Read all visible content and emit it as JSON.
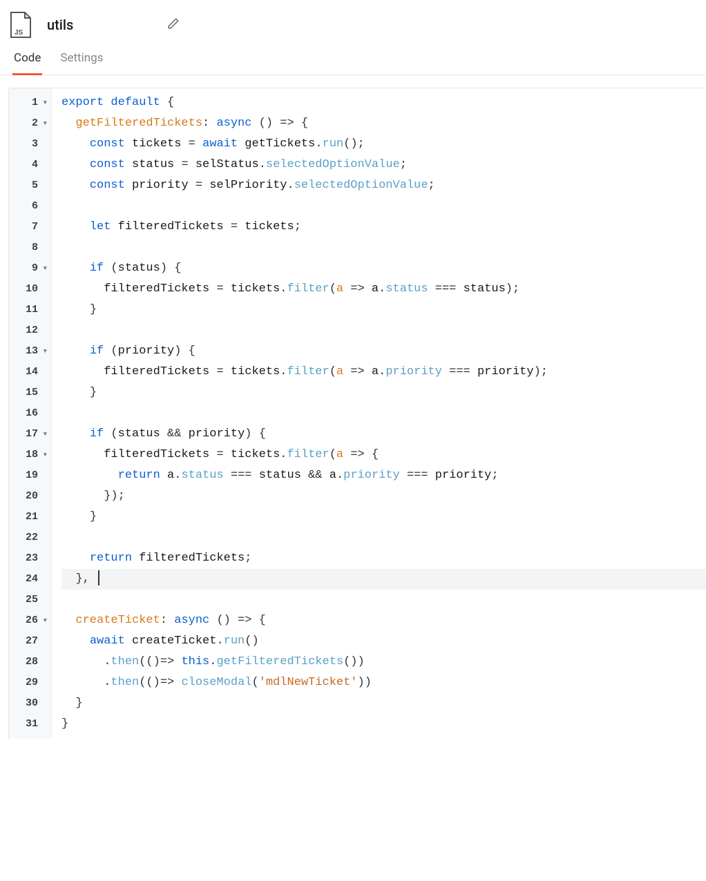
{
  "header": {
    "file_type": "JS",
    "title": "utils"
  },
  "tabs": [
    {
      "label": "Code",
      "active": true
    },
    {
      "label": "Settings",
      "active": false
    }
  ],
  "editor": {
    "highlighted_line": 24,
    "lines": [
      {
        "n": 1,
        "fold": true,
        "tokens": [
          [
            "kw",
            "export"
          ],
          [
            "sp",
            " "
          ],
          [
            "kw",
            "default"
          ],
          [
            "sp",
            " "
          ],
          [
            "op",
            "{"
          ]
        ]
      },
      {
        "n": 2,
        "fold": true,
        "tokens": [
          [
            "sp",
            "  "
          ],
          [
            "def",
            "getFilteredTickets"
          ],
          [
            "op",
            ":"
          ],
          [
            "sp",
            " "
          ],
          [
            "kw",
            "async"
          ],
          [
            "sp",
            " "
          ],
          [
            "op",
            "()"
          ],
          [
            "sp",
            " "
          ],
          [
            "op",
            "=>"
          ],
          [
            "sp",
            " "
          ],
          [
            "op",
            "{"
          ]
        ]
      },
      {
        "n": 3,
        "fold": false,
        "tokens": [
          [
            "sp",
            "    "
          ],
          [
            "kw",
            "const"
          ],
          [
            "sp",
            " "
          ],
          [
            "txt",
            "tickets"
          ],
          [
            "sp",
            " "
          ],
          [
            "op",
            "="
          ],
          [
            "sp",
            " "
          ],
          [
            "kw",
            "await"
          ],
          [
            "sp",
            " "
          ],
          [
            "txt",
            "getTickets"
          ],
          [
            "op",
            "."
          ],
          [
            "fn",
            "run"
          ],
          [
            "op",
            "();"
          ]
        ]
      },
      {
        "n": 4,
        "fold": false,
        "tokens": [
          [
            "sp",
            "    "
          ],
          [
            "kw",
            "const"
          ],
          [
            "sp",
            " "
          ],
          [
            "txt",
            "status"
          ],
          [
            "sp",
            " "
          ],
          [
            "op",
            "="
          ],
          [
            "sp",
            " "
          ],
          [
            "txt",
            "selStatus"
          ],
          [
            "op",
            "."
          ],
          [
            "prop",
            "selectedOptionValue"
          ],
          [
            "op",
            ";"
          ]
        ]
      },
      {
        "n": 5,
        "fold": false,
        "tokens": [
          [
            "sp",
            "    "
          ],
          [
            "kw",
            "const"
          ],
          [
            "sp",
            " "
          ],
          [
            "txt",
            "priority"
          ],
          [
            "sp",
            " "
          ],
          [
            "op",
            "="
          ],
          [
            "sp",
            " "
          ],
          [
            "txt",
            "selPriority"
          ],
          [
            "op",
            "."
          ],
          [
            "prop",
            "selectedOptionValue"
          ],
          [
            "op",
            ";"
          ]
        ]
      },
      {
        "n": 6,
        "fold": false,
        "tokens": []
      },
      {
        "n": 7,
        "fold": false,
        "tokens": [
          [
            "sp",
            "    "
          ],
          [
            "kw",
            "let"
          ],
          [
            "sp",
            " "
          ],
          [
            "txt",
            "filteredTickets"
          ],
          [
            "sp",
            " "
          ],
          [
            "op",
            "="
          ],
          [
            "sp",
            " "
          ],
          [
            "txt",
            "tickets"
          ],
          [
            "op",
            ";"
          ]
        ]
      },
      {
        "n": 8,
        "fold": false,
        "tokens": []
      },
      {
        "n": 9,
        "fold": true,
        "tokens": [
          [
            "sp",
            "    "
          ],
          [
            "kw",
            "if"
          ],
          [
            "sp",
            " "
          ],
          [
            "op",
            "("
          ],
          [
            "txt",
            "status"
          ],
          [
            "op",
            ")"
          ],
          [
            "sp",
            " "
          ],
          [
            "op",
            "{"
          ]
        ]
      },
      {
        "n": 10,
        "fold": false,
        "tokens": [
          [
            "sp",
            "      "
          ],
          [
            "txt",
            "filteredTickets"
          ],
          [
            "sp",
            " "
          ],
          [
            "op",
            "="
          ],
          [
            "sp",
            " "
          ],
          [
            "txt",
            "tickets"
          ],
          [
            "op",
            "."
          ],
          [
            "fn",
            "filter"
          ],
          [
            "op",
            "("
          ],
          [
            "param",
            "a"
          ],
          [
            "sp",
            " "
          ],
          [
            "op",
            "=>"
          ],
          [
            "sp",
            " "
          ],
          [
            "txt",
            "a"
          ],
          [
            "op",
            "."
          ],
          [
            "prop",
            "status"
          ],
          [
            "sp",
            " "
          ],
          [
            "op",
            "==="
          ],
          [
            "sp",
            " "
          ],
          [
            "txt",
            "status"
          ],
          [
            "op",
            ");"
          ]
        ]
      },
      {
        "n": 11,
        "fold": false,
        "tokens": [
          [
            "sp",
            "    "
          ],
          [
            "op",
            "}"
          ]
        ]
      },
      {
        "n": 12,
        "fold": false,
        "tokens": []
      },
      {
        "n": 13,
        "fold": true,
        "tokens": [
          [
            "sp",
            "    "
          ],
          [
            "kw",
            "if"
          ],
          [
            "sp",
            " "
          ],
          [
            "op",
            "("
          ],
          [
            "txt",
            "priority"
          ],
          [
            "op",
            ")"
          ],
          [
            "sp",
            " "
          ],
          [
            "op",
            "{"
          ]
        ]
      },
      {
        "n": 14,
        "fold": false,
        "tokens": [
          [
            "sp",
            "      "
          ],
          [
            "txt",
            "filteredTickets"
          ],
          [
            "sp",
            " "
          ],
          [
            "op",
            "="
          ],
          [
            "sp",
            " "
          ],
          [
            "txt",
            "tickets"
          ],
          [
            "op",
            "."
          ],
          [
            "fn",
            "filter"
          ],
          [
            "op",
            "("
          ],
          [
            "param",
            "a"
          ],
          [
            "sp",
            " "
          ],
          [
            "op",
            "=>"
          ],
          [
            "sp",
            " "
          ],
          [
            "txt",
            "a"
          ],
          [
            "op",
            "."
          ],
          [
            "prop",
            "priority"
          ],
          [
            "sp",
            " "
          ],
          [
            "op",
            "==="
          ],
          [
            "sp",
            " "
          ],
          [
            "txt",
            "priority"
          ],
          [
            "op",
            ");"
          ]
        ]
      },
      {
        "n": 15,
        "fold": false,
        "tokens": [
          [
            "sp",
            "    "
          ],
          [
            "op",
            "}"
          ]
        ]
      },
      {
        "n": 16,
        "fold": false,
        "tokens": []
      },
      {
        "n": 17,
        "fold": true,
        "tokens": [
          [
            "sp",
            "    "
          ],
          [
            "kw",
            "if"
          ],
          [
            "sp",
            " "
          ],
          [
            "op",
            "("
          ],
          [
            "txt",
            "status"
          ],
          [
            "sp",
            " "
          ],
          [
            "op",
            "&&"
          ],
          [
            "sp",
            " "
          ],
          [
            "txt",
            "priority"
          ],
          [
            "op",
            ")"
          ],
          [
            "sp",
            " "
          ],
          [
            "op",
            "{"
          ]
        ]
      },
      {
        "n": 18,
        "fold": true,
        "tokens": [
          [
            "sp",
            "      "
          ],
          [
            "txt",
            "filteredTickets"
          ],
          [
            "sp",
            " "
          ],
          [
            "op",
            "="
          ],
          [
            "sp",
            " "
          ],
          [
            "txt",
            "tickets"
          ],
          [
            "op",
            "."
          ],
          [
            "fn",
            "filter"
          ],
          [
            "op",
            "("
          ],
          [
            "param",
            "a"
          ],
          [
            "sp",
            " "
          ],
          [
            "op",
            "=>"
          ],
          [
            "sp",
            " "
          ],
          [
            "op",
            "{"
          ]
        ]
      },
      {
        "n": 19,
        "fold": false,
        "tokens": [
          [
            "sp",
            "        "
          ],
          [
            "kw",
            "return"
          ],
          [
            "sp",
            " "
          ],
          [
            "txt",
            "a"
          ],
          [
            "op",
            "."
          ],
          [
            "prop",
            "status"
          ],
          [
            "sp",
            " "
          ],
          [
            "op",
            "==="
          ],
          [
            "sp",
            " "
          ],
          [
            "txt",
            "status"
          ],
          [
            "sp",
            " "
          ],
          [
            "op",
            "&&"
          ],
          [
            "sp",
            " "
          ],
          [
            "txt",
            "a"
          ],
          [
            "op",
            "."
          ],
          [
            "prop",
            "priority"
          ],
          [
            "sp",
            " "
          ],
          [
            "op",
            "==="
          ],
          [
            "sp",
            " "
          ],
          [
            "txt",
            "priority"
          ],
          [
            "op",
            ";"
          ]
        ]
      },
      {
        "n": 20,
        "fold": false,
        "tokens": [
          [
            "sp",
            "      "
          ],
          [
            "op",
            "});"
          ]
        ]
      },
      {
        "n": 21,
        "fold": false,
        "tokens": [
          [
            "sp",
            "    "
          ],
          [
            "op",
            "}"
          ]
        ]
      },
      {
        "n": 22,
        "fold": false,
        "tokens": []
      },
      {
        "n": 23,
        "fold": false,
        "tokens": [
          [
            "sp",
            "    "
          ],
          [
            "kw",
            "return"
          ],
          [
            "sp",
            " "
          ],
          [
            "txt",
            "filteredTickets"
          ],
          [
            "op",
            ";"
          ]
        ]
      },
      {
        "n": 24,
        "fold": false,
        "tokens": [
          [
            "sp",
            "  "
          ],
          [
            "op",
            "},"
          ],
          [
            "sp",
            " "
          ],
          [
            "cursor",
            ""
          ]
        ]
      },
      {
        "n": 25,
        "fold": false,
        "tokens": []
      },
      {
        "n": 26,
        "fold": true,
        "tokens": [
          [
            "sp",
            "  "
          ],
          [
            "def",
            "createTicket"
          ],
          [
            "op",
            ":"
          ],
          [
            "sp",
            " "
          ],
          [
            "kw",
            "async"
          ],
          [
            "sp",
            " "
          ],
          [
            "op",
            "()"
          ],
          [
            "sp",
            " "
          ],
          [
            "op",
            "=>"
          ],
          [
            "sp",
            " "
          ],
          [
            "op",
            "{"
          ]
        ]
      },
      {
        "n": 27,
        "fold": false,
        "tokens": [
          [
            "sp",
            "    "
          ],
          [
            "kw",
            "await"
          ],
          [
            "sp",
            " "
          ],
          [
            "txt",
            "createTicket"
          ],
          [
            "op",
            "."
          ],
          [
            "fn",
            "run"
          ],
          [
            "op",
            "()"
          ]
        ]
      },
      {
        "n": 28,
        "fold": false,
        "tokens": [
          [
            "sp",
            "      "
          ],
          [
            "op",
            "."
          ],
          [
            "fn",
            "then"
          ],
          [
            "op",
            "(()"
          ],
          [
            "op",
            "=>"
          ],
          [
            "sp",
            " "
          ],
          [
            "this",
            "this"
          ],
          [
            "op",
            "."
          ],
          [
            "fn",
            "getFilteredTickets"
          ],
          [
            "op",
            "())"
          ]
        ]
      },
      {
        "n": 29,
        "fold": false,
        "tokens": [
          [
            "sp",
            "      "
          ],
          [
            "op",
            "."
          ],
          [
            "fn",
            "then"
          ],
          [
            "op",
            "(()"
          ],
          [
            "op",
            "=>"
          ],
          [
            "sp",
            " "
          ],
          [
            "fn",
            "closeModal"
          ],
          [
            "op",
            "("
          ],
          [
            "str",
            "'mdlNewTicket'"
          ],
          [
            "op",
            "))"
          ]
        ]
      },
      {
        "n": 30,
        "fold": false,
        "tokens": [
          [
            "sp",
            "  "
          ],
          [
            "op",
            "}"
          ]
        ]
      },
      {
        "n": 31,
        "fold": false,
        "tokens": [
          [
            "op",
            "}"
          ]
        ]
      }
    ]
  }
}
